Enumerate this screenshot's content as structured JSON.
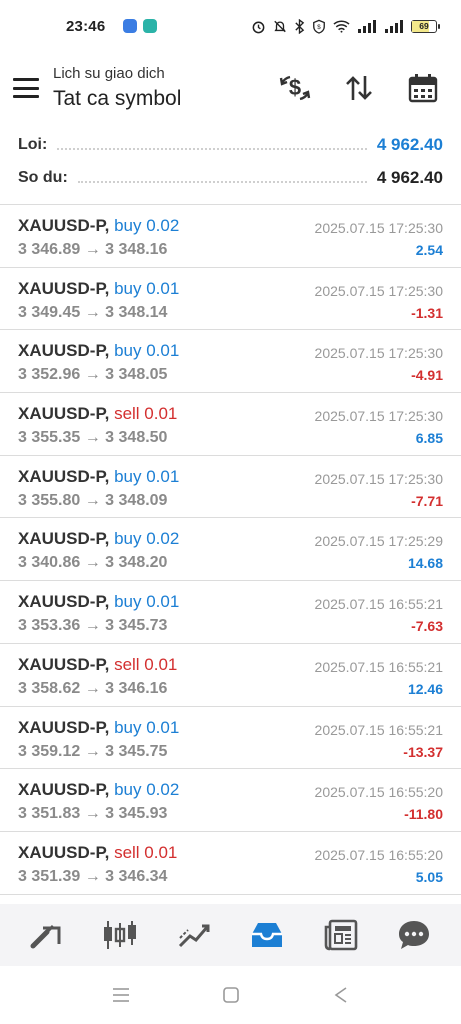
{
  "status_bar": {
    "time": "23:46",
    "battery_level": "69",
    "app_icon_colors": [
      "#3b7de3",
      "#2bb3a8"
    ]
  },
  "header": {
    "subtitle": "Lich su giao dich",
    "title": "Tat ca symbol",
    "actions": [
      "currency-exchange-icon",
      "sort-arrows-icon",
      "calendar-icon"
    ]
  },
  "summary": {
    "profit_label": "Loi:",
    "profit_value": "4 962.40",
    "balance_label": "So du:",
    "balance_value": "4 962.40"
  },
  "deals": [
    {
      "symbol": "XAUUSD-P,",
      "type": "buy 0.02",
      "side": "buy",
      "prices": "3 346.89 → 3 348.16",
      "time": "2025.07.15 17:25:30",
      "profit": "2.54",
      "sign": "pos"
    },
    {
      "symbol": "XAUUSD-P,",
      "type": "buy 0.01",
      "side": "buy",
      "prices": "3 349.45 → 3 348.14",
      "time": "2025.07.15 17:25:30",
      "profit": "-1.31",
      "sign": "neg"
    },
    {
      "symbol": "XAUUSD-P,",
      "type": "buy 0.01",
      "side": "buy",
      "prices": "3 352.96 → 3 348.05",
      "time": "2025.07.15 17:25:30",
      "profit": "-4.91",
      "sign": "neg"
    },
    {
      "symbol": "XAUUSD-P,",
      "type": "sell 0.01",
      "side": "sell",
      "prices": "3 355.35 → 3 348.50",
      "time": "2025.07.15 17:25:30",
      "profit": "6.85",
      "sign": "pos"
    },
    {
      "symbol": "XAUUSD-P,",
      "type": "buy 0.01",
      "side": "buy",
      "prices": "3 355.80 → 3 348.09",
      "time": "2025.07.15 17:25:30",
      "profit": "-7.71",
      "sign": "neg"
    },
    {
      "symbol": "XAUUSD-P,",
      "type": "buy 0.02",
      "side": "buy",
      "prices": "3 340.86 → 3 348.20",
      "time": "2025.07.15 17:25:29",
      "profit": "14.68",
      "sign": "pos"
    },
    {
      "symbol": "XAUUSD-P,",
      "type": "buy 0.01",
      "side": "buy",
      "prices": "3 353.36 → 3 345.73",
      "time": "2025.07.15 16:55:21",
      "profit": "-7.63",
      "sign": "neg"
    },
    {
      "symbol": "XAUUSD-P,",
      "type": "sell 0.01",
      "side": "sell",
      "prices": "3 358.62 → 3 346.16",
      "time": "2025.07.15 16:55:21",
      "profit": "12.46",
      "sign": "pos"
    },
    {
      "symbol": "XAUUSD-P,",
      "type": "buy 0.01",
      "side": "buy",
      "prices": "3 359.12 → 3 345.75",
      "time": "2025.07.15 16:55:21",
      "profit": "-13.37",
      "sign": "neg"
    },
    {
      "symbol": "XAUUSD-P,",
      "type": "buy 0.02",
      "side": "buy",
      "prices": "3 351.83 → 3 345.93",
      "time": "2025.07.15 16:55:20",
      "profit": "-11.80",
      "sign": "neg"
    },
    {
      "symbol": "XAUUSD-P,",
      "type": "sell 0.01",
      "side": "sell",
      "prices": "3 351.39 → 3 346.34",
      "time": "2025.07.15 16:55:20",
      "profit": "5.05",
      "sign": "pos"
    }
  ],
  "bottom_nav": [
    {
      "name": "quotes-icon",
      "active": false
    },
    {
      "name": "chart-icon",
      "active": false
    },
    {
      "name": "trade-icon",
      "active": false
    },
    {
      "name": "history-icon",
      "active": true
    },
    {
      "name": "news-icon",
      "active": false
    },
    {
      "name": "messages-icon",
      "active": false
    }
  ],
  "colors": {
    "accent": "#1c7fd4",
    "loss": "#d32f2f",
    "muted": "#8a8a8a",
    "nav_active": "#1c7fd4",
    "nav_inactive": "#555555"
  }
}
